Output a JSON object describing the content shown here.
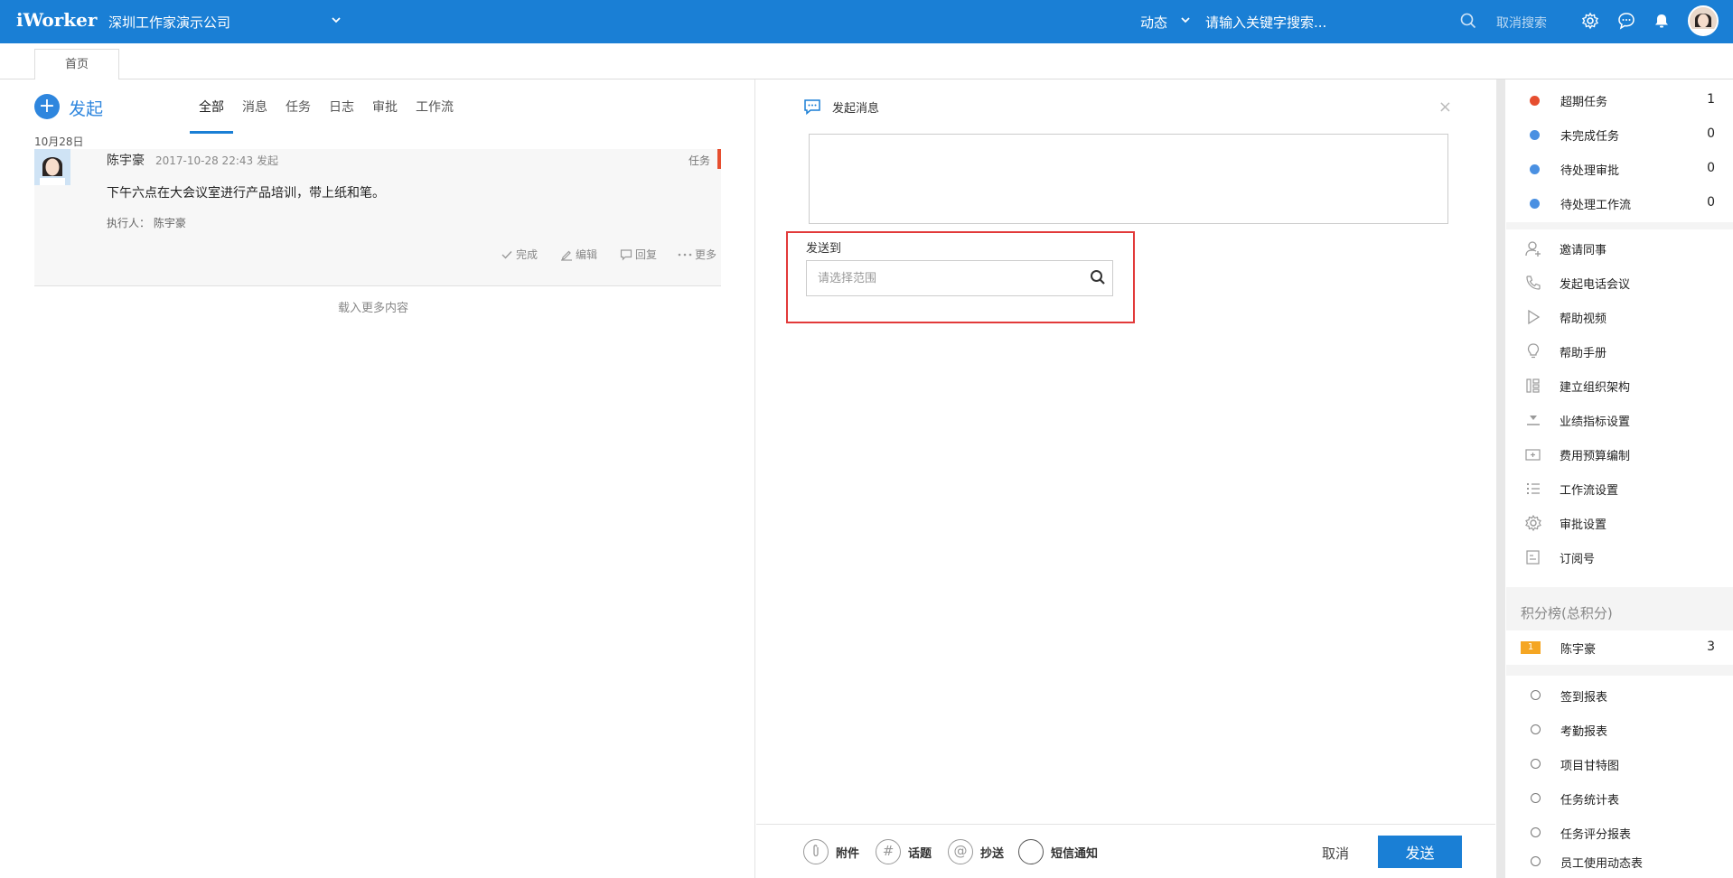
{
  "header": {
    "logo": "iWorker",
    "company": "深圳工作家演示公司",
    "dynamic_label": "动态",
    "search_placeholder": "请输入关键字搜索...",
    "cancel_search": "取消搜索",
    "bar_color": "#1a7fd5"
  },
  "tabs": {
    "home": "首页"
  },
  "feed": {
    "launch_label": "发起",
    "filters": [
      "全部",
      "消息",
      "任务",
      "日志",
      "审批",
      "工作流"
    ],
    "date": "10月28日",
    "item": {
      "author": "陈宇豪",
      "time": "2017-10-28 22:43 发起",
      "tag": "任务",
      "tag_color": "#e64e2f",
      "content": "下午六点在大会议室进行产品培训，带上纸和笔。",
      "executor": "执行人： 陈宇豪",
      "actions": {
        "complete": "完成",
        "edit": "编辑",
        "reply": "回复",
        "more": "更多"
      }
    },
    "load_more": "载入更多内容"
  },
  "compose": {
    "title": "发起消息",
    "close": "×",
    "sendto_label": "发送到",
    "sendto_placeholder": "请选择范围",
    "tools": {
      "attach": "附件",
      "topic": "话题",
      "cc": "抄送",
      "sms": "短信通知"
    },
    "cancel": "取消",
    "send": "发送"
  },
  "sidebar": {
    "stats": [
      {
        "label": "超期任务",
        "count": "1",
        "color": "#e64e2f"
      },
      {
        "label": "未完成任务",
        "count": "0",
        "color": "#4a90e2"
      },
      {
        "label": "待处理审批",
        "count": "0",
        "color": "#4a90e2"
      },
      {
        "label": "待处理工作流",
        "count": "0",
        "color": "#4a90e2"
      }
    ],
    "links": [
      {
        "label": "邀请同事",
        "icon": "user-add-icon"
      },
      {
        "label": "发起电话会议",
        "icon": "phone-icon"
      },
      {
        "label": "帮助视频",
        "icon": "play-icon"
      },
      {
        "label": "帮助手册",
        "icon": "bulb-icon"
      },
      {
        "label": "建立组织架构",
        "icon": "org-chart-icon"
      },
      {
        "label": "业绩指标设置",
        "icon": "download-icon"
      },
      {
        "label": "费用预算编制",
        "icon": "budget-icon"
      },
      {
        "label": "工作流设置",
        "icon": "list-icon"
      },
      {
        "label": "审批设置",
        "icon": "gear-icon"
      },
      {
        "label": "订阅号",
        "icon": "document-icon"
      }
    ],
    "rank_title": "积分榜(总积分)",
    "rank": [
      {
        "rank": "1",
        "name": "陈宇豪",
        "score": "3"
      }
    ],
    "reports": [
      "签到报表",
      "考勤报表",
      "项目甘特图",
      "任务统计表",
      "任务评分报表",
      "员工使用动态表"
    ]
  }
}
